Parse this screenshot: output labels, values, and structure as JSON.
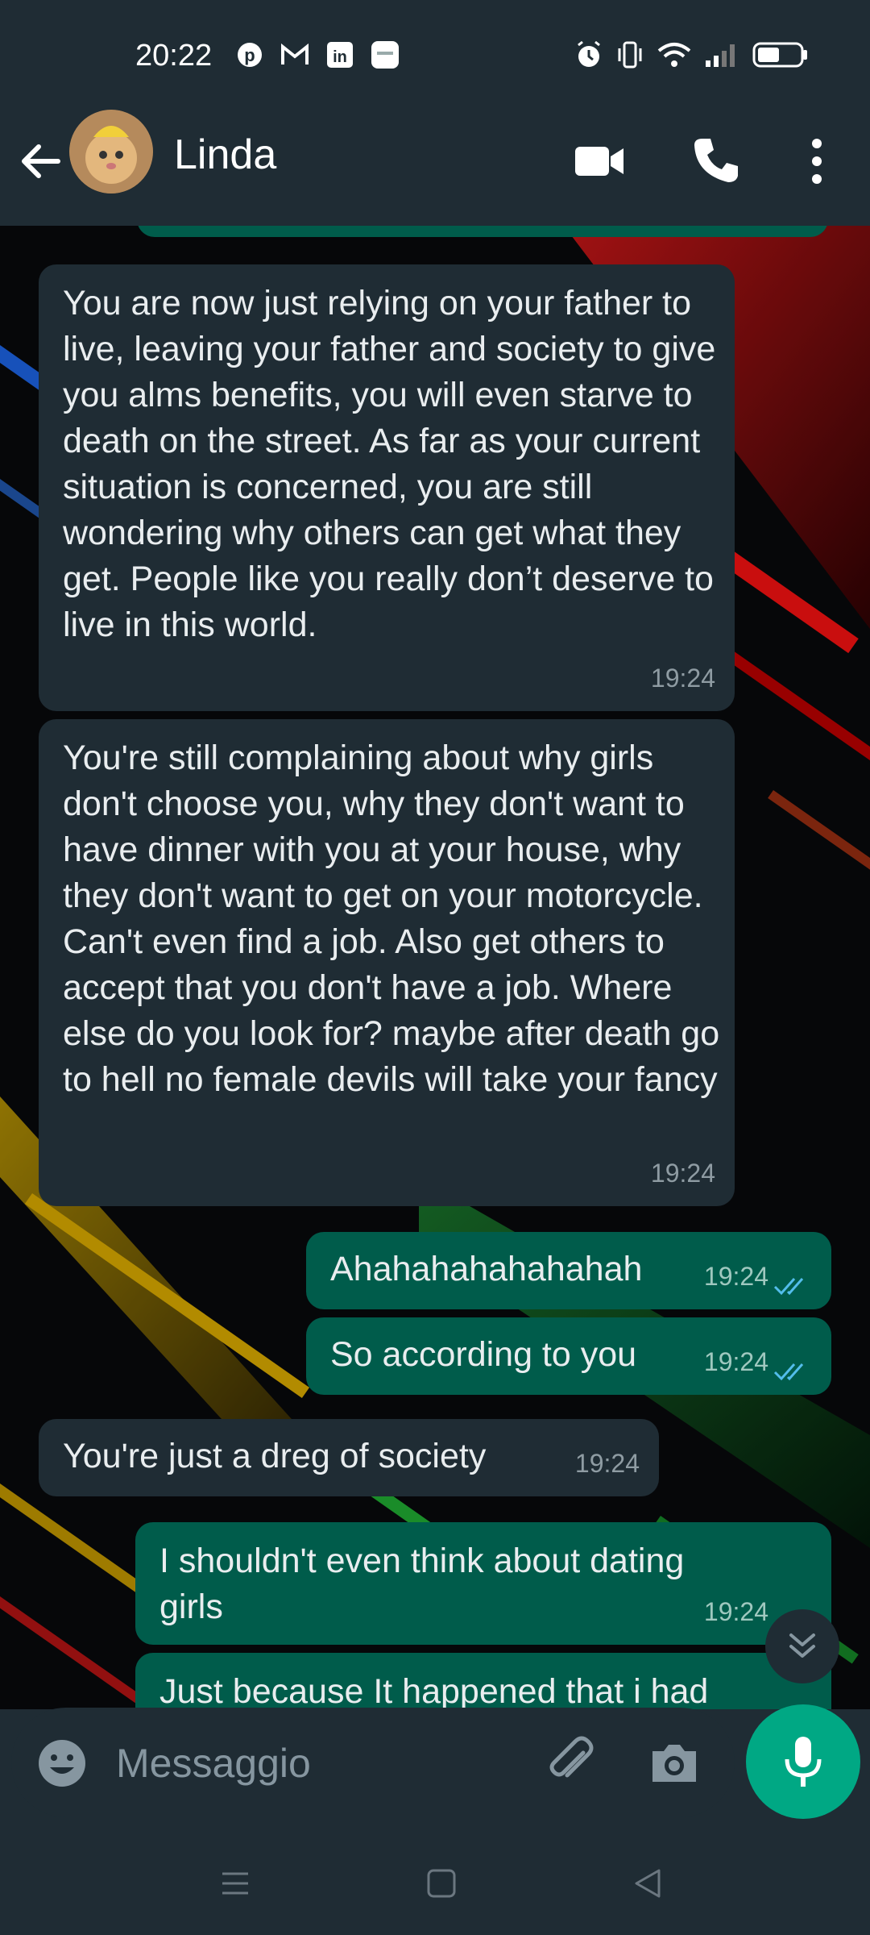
{
  "status_bar": {
    "time": "20:22",
    "left_icons": [
      "pinterest-icon",
      "gmail-icon",
      "linkedin-icon",
      "app-icon"
    ],
    "right_icons": [
      "alarm-icon",
      "vibrate-icon",
      "wifi-icon",
      "signal-icon",
      "battery-icon"
    ]
  },
  "header": {
    "contact_name": "Linda",
    "icons": [
      "back-arrow-icon",
      "video-call-icon",
      "phone-icon",
      "more-vert-icon"
    ]
  },
  "messages": [
    {
      "direction": "in",
      "text": "You are now just relying on your father to live, leaving your father and society to give you alms benefits, you will even starve to death on the street. As far as your current situation is concerned, you are still wondering why others can get what they get. People like you really don’t deserve to live in this world.",
      "time": "19:24"
    },
    {
      "direction": "in",
      "text": "You're still complaining about why girls don't choose you, why they don't want to have dinner with you at your house, why they don't want to get on your motorcycle. Can't even find a job. Also get others to accept that you don't have a job. Where else do you look for? maybe after death go to hell no female devils will take your fancy",
      "time": "19:24"
    },
    {
      "direction": "out",
      "text": "Ahahahahahahahah",
      "time": "19:24",
      "status": "read"
    },
    {
      "direction": "out",
      "text": "So according to you",
      "time": "19:24",
      "status": "read"
    },
    {
      "direction": "in",
      "text": "You're just a dreg of society",
      "time": "19:24"
    },
    {
      "direction": "out",
      "text": "I shouldn't even think about dating girls",
      "time": "19:24",
      "status": "read"
    },
    {
      "direction": "out",
      "text": "Just because It happened that i had",
      "time": "",
      "status": ""
    }
  ],
  "input": {
    "placeholder": "Messaggio"
  },
  "colors": {
    "bar_bg": "#1f2c34",
    "incoming_bubble": "#1f2c34",
    "outgoing_bubble": "#005c4b",
    "accent": "#00a884",
    "read_ticks": "#53bdeb"
  }
}
